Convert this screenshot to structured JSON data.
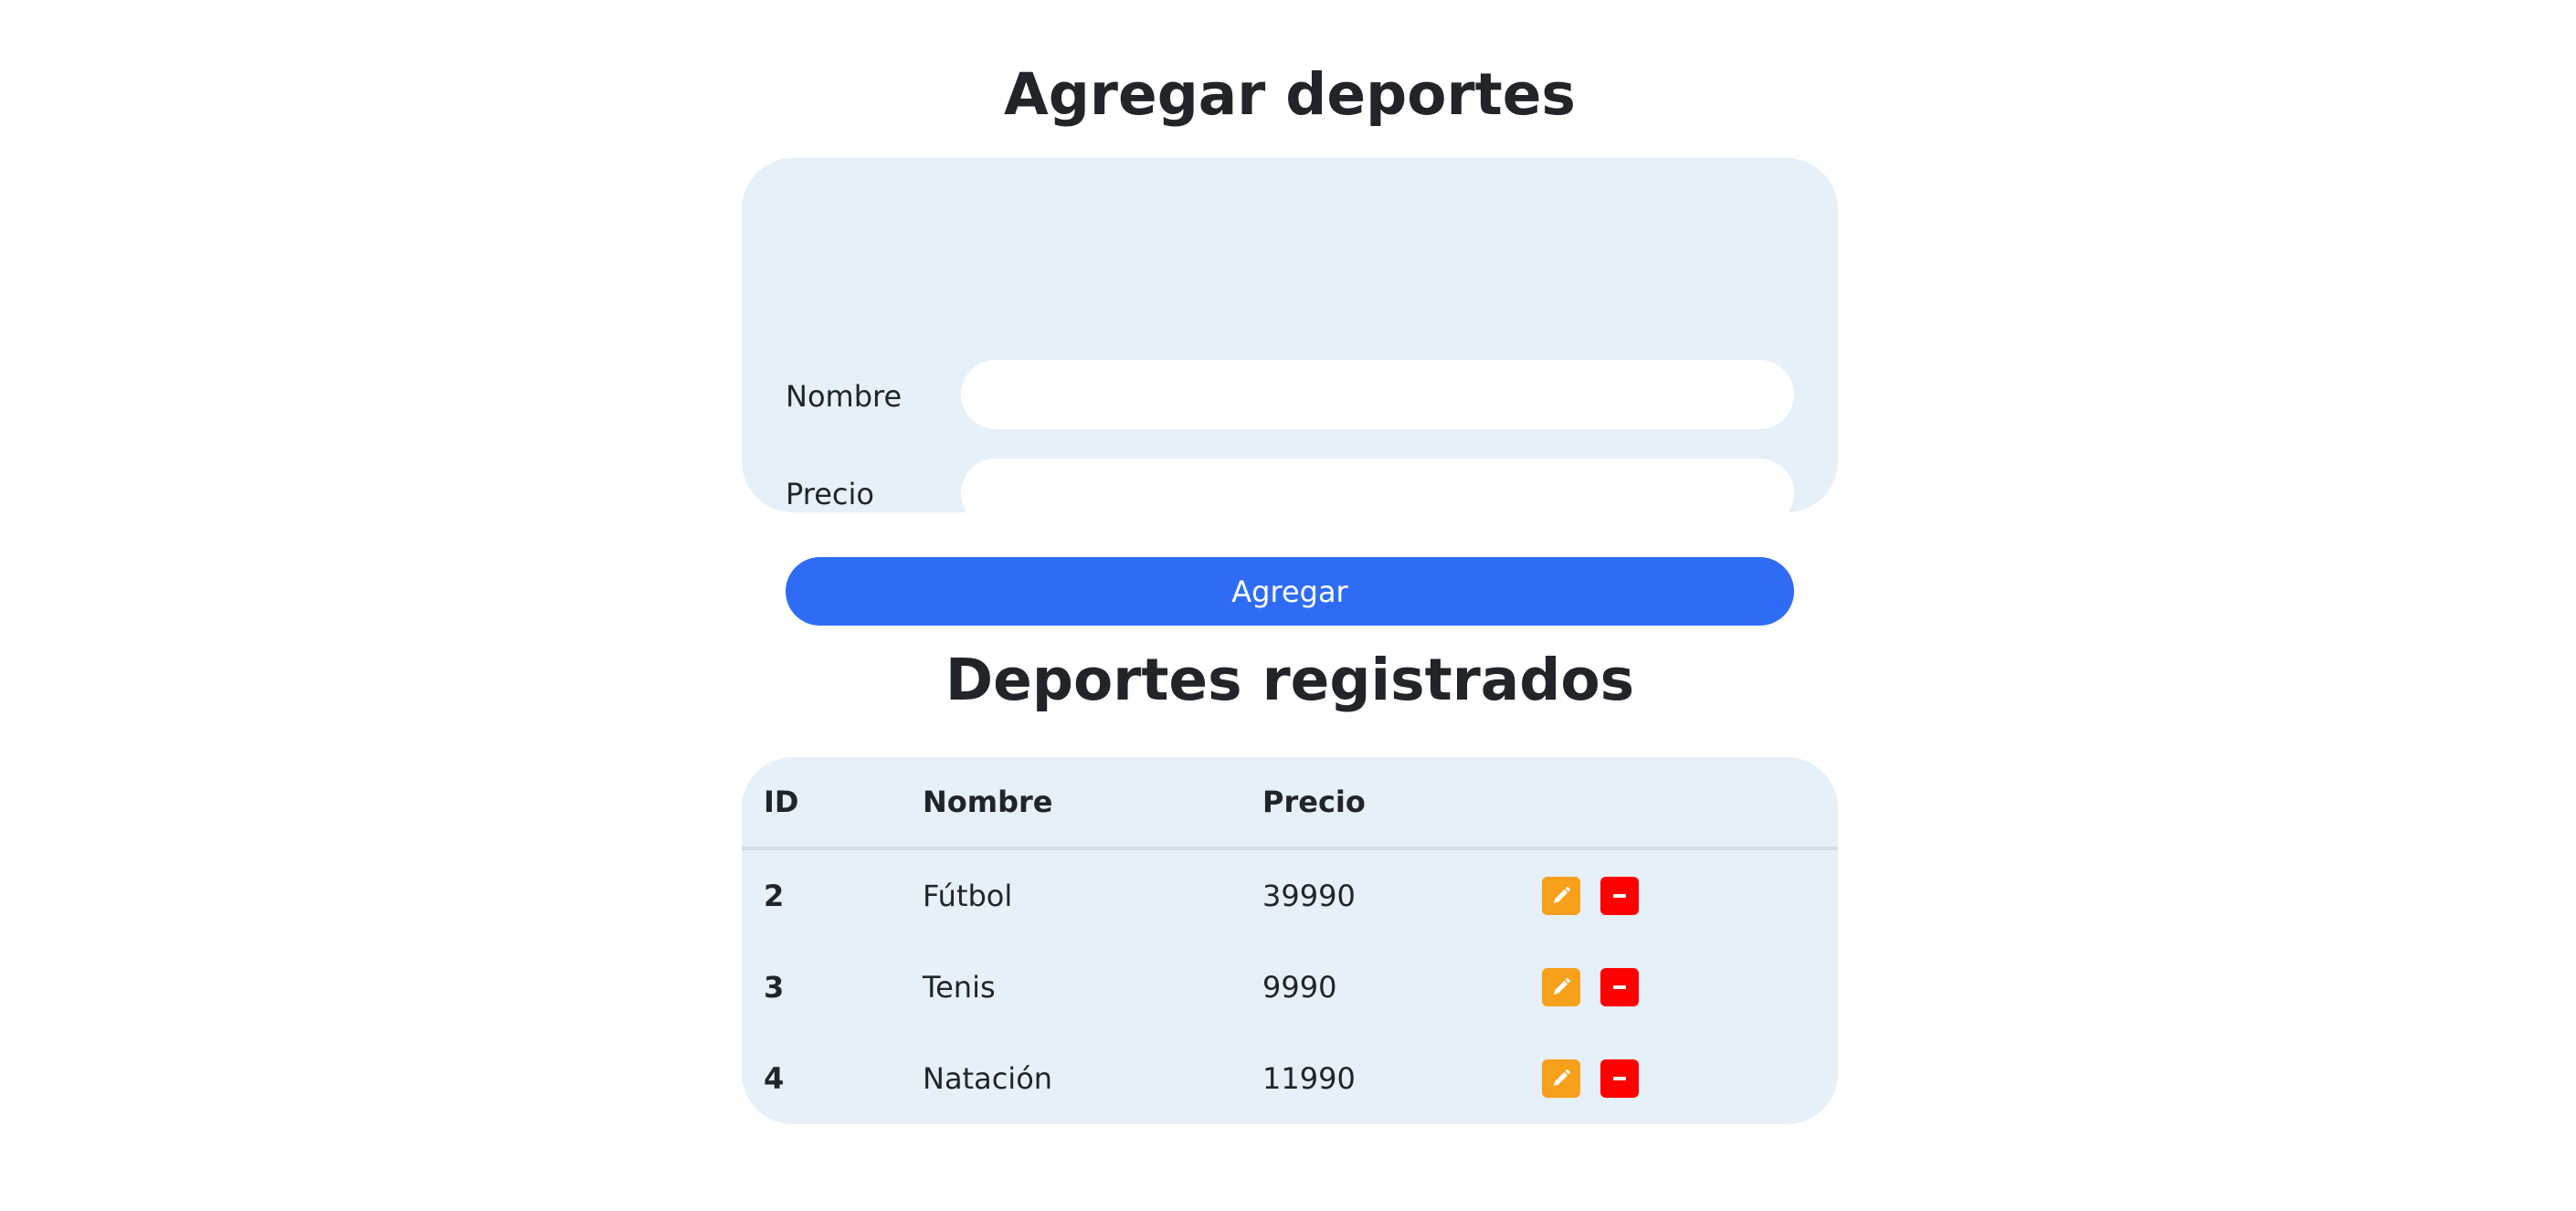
{
  "form_section": {
    "title": "Agregar deportes",
    "nombre_label": "Nombre",
    "nombre_value": "",
    "precio_label": "Precio",
    "precio_value": "",
    "submit_label": "Agregar"
  },
  "table_section": {
    "title": "Deportes registrados",
    "headers": [
      "ID",
      "Nombre",
      "Precio",
      ""
    ],
    "rows": [
      {
        "id": "2",
        "nombre": "Fútbol",
        "precio": "39990"
      },
      {
        "id": "3",
        "nombre": "Tenis",
        "precio": "9990"
      },
      {
        "id": "4",
        "nombre": "Natación",
        "precio": "11990"
      }
    ],
    "row_actions": [
      "pencil-icon",
      "minus-icon"
    ]
  },
  "colors": {
    "card_bg": "#e6f0f8",
    "primary": "#2f6cf6",
    "edit": "#f7a01b",
    "delete": "#ff0000"
  }
}
